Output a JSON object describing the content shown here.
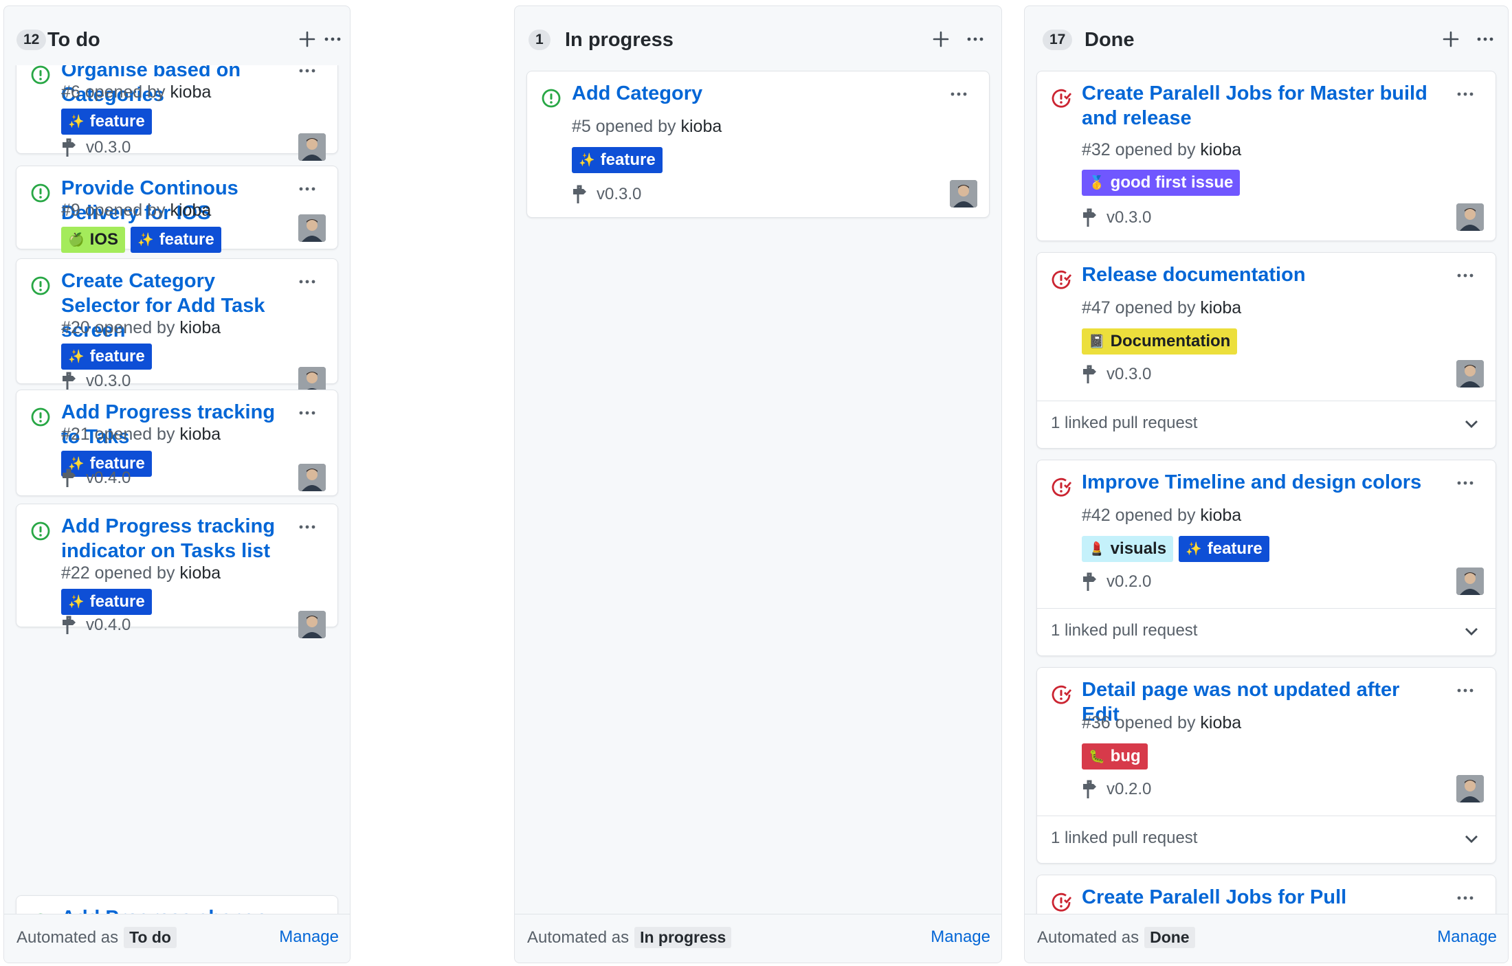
{
  "columns": [
    {
      "count": "12",
      "title": "To do",
      "automated_label": "Automated as",
      "automated_value": "To do",
      "manage_label": "Manage",
      "cards": [
        {
          "title": "Organise based on Categories",
          "number": "#6",
          "opened_by": "opened by",
          "author": "kioba",
          "state": "open",
          "labels": [
            {
              "text": "feature",
              "emoji": "✨",
              "bg": "#0e4fd6",
              "fg": "#ffffff"
            }
          ],
          "milestone": "v0.3.0"
        },
        {
          "title": "Provide Continous Delivery for IOS",
          "number": "#9",
          "opened_by": "opened by",
          "author": "kioba",
          "state": "open",
          "labels": [
            {
              "text": "IOS",
              "emoji": "🍏",
              "bg": "#a4eb5b",
              "fg": "#1b1f23"
            },
            {
              "text": "feature",
              "emoji": "✨",
              "bg": "#0e4fd6",
              "fg": "#ffffff"
            }
          ],
          "milestone": ""
        },
        {
          "title": "Create Category Selector for Add Task screen",
          "number": "#20",
          "opened_by": "opened by",
          "author": "kioba",
          "state": "open",
          "labels": [
            {
              "text": "feature",
              "emoji": "✨",
              "bg": "#0e4fd6",
              "fg": "#ffffff"
            }
          ],
          "milestone": "v0.3.0"
        },
        {
          "title": "Add Progress tracking to Taks",
          "number": "#21",
          "opened_by": "opened by",
          "author": "kioba",
          "state": "open",
          "labels": [
            {
              "text": "feature",
              "emoji": "✨",
              "bg": "#0e4fd6",
              "fg": "#ffffff"
            }
          ],
          "milestone": "v0.4.0"
        },
        {
          "title": "Add Progress tracking indicator on Tasks list",
          "number": "#22",
          "opened_by": "opened by",
          "author": "kioba",
          "state": "open",
          "labels": [
            {
              "text": "feature",
              "emoji": "✨",
              "bg": "#0e4fd6",
              "fg": "#ffffff"
            }
          ],
          "milestone": "v0.4.0"
        },
        {
          "title": "Add Progress change UI to Tasks",
          "state": "open"
        }
      ]
    },
    {
      "count": "1",
      "title": "In progress",
      "automated_label": "Automated as",
      "automated_value": "In progress",
      "manage_label": "Manage",
      "cards": [
        {
          "title": "Add Category",
          "number": "#5",
          "opened_by": "opened by",
          "author": "kioba",
          "state": "open",
          "labels": [
            {
              "text": "feature",
              "emoji": "✨",
              "bg": "#0e4fd6",
              "fg": "#ffffff"
            }
          ],
          "milestone": "v0.3.0"
        }
      ]
    },
    {
      "count": "17",
      "title": "Done",
      "automated_label": "Automated as",
      "automated_value": "Done",
      "manage_label": "Manage",
      "cards": [
        {
          "title": "Create Paralell Jobs for Master build and release",
          "number": "#32",
          "opened_by": "opened by",
          "author": "kioba",
          "state": "closed",
          "labels": [
            {
              "text": "good first issue",
              "emoji": "🥇",
              "bg": "#7057ff",
              "fg": "#ffffff"
            }
          ],
          "milestone": "v0.3.0"
        },
        {
          "title": "Release documentation",
          "number": "#47",
          "opened_by": "opened by",
          "author": "kioba",
          "state": "closed",
          "labels": [
            {
              "text": "Documentation",
              "emoji": "📓",
              "bg": "#ecdf3c",
              "fg": "#1b1f23"
            }
          ],
          "milestone": "v0.3.0",
          "linked_pr": "1 linked pull request"
        },
        {
          "title": "Improve Timeline and design colors",
          "number": "#42",
          "opened_by": "opened by",
          "author": "kioba",
          "state": "closed",
          "labels": [
            {
              "text": "visuals",
              "emoji": "💄",
              "bg": "#c5f1fb",
              "fg": "#1b1f23"
            },
            {
              "text": "feature",
              "emoji": "✨",
              "bg": "#0e4fd6",
              "fg": "#ffffff"
            }
          ],
          "milestone": "v0.2.0",
          "linked_pr": "1 linked pull request"
        },
        {
          "title": "Detail page was not updated after Edit",
          "number": "#36",
          "opened_by": "opened by",
          "author": "kioba",
          "state": "closed",
          "labels": [
            {
              "text": "bug",
              "emoji": "🐛",
              "bg": "#d73a4a",
              "fg": "#ffffff"
            }
          ],
          "milestone": "v0.2.0",
          "linked_pr": "1 linked pull request"
        },
        {
          "title": "Create Paralell Jobs for Pull Requests",
          "state": "closed"
        }
      ]
    }
  ],
  "colors": {
    "link": "#0366d6",
    "open": "#28a745",
    "closed": "#cb2431"
  }
}
